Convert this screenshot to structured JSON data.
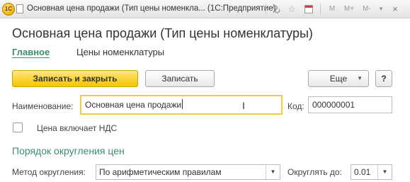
{
  "window": {
    "app_logo": "1С",
    "title": "Основная цена продажи (Тип цены номенкла... (1С:Предприятие)",
    "buttons": {
      "m": "M",
      "m_plus": "M+",
      "m_minus": "M-",
      "dropdown": "▼",
      "close": "×"
    },
    "star": "☆"
  },
  "form": {
    "title": "Основная цена продажи (Тип цены номенклатуры)",
    "tabs": [
      {
        "label": "Главное",
        "active": true
      },
      {
        "label": "Цены номенклатуры",
        "active": false
      }
    ]
  },
  "command_bar": {
    "save_close": "Записать и закрыть",
    "save": "Записать",
    "more": "Еще",
    "more_caret": "▼",
    "help": "?"
  },
  "fields": {
    "name_label": "Наименование:",
    "name_value": "Основная цена продажи",
    "code_label": "Код:",
    "code_value": "000000001",
    "vat_label": "Цена включает НДС",
    "vat_checked": false
  },
  "rounding": {
    "section_title": "Порядок округления цен",
    "method_label": "Метод округления:",
    "method_value": "По арифметическим правилам",
    "round_to_label": "Округлять до:",
    "round_to_value": "0.01",
    "dd_icon": "▼"
  },
  "colors": {
    "accent_green": "#3a8f6b",
    "primary_button": "#f5c400",
    "focus_border": "#f0cc3a"
  }
}
